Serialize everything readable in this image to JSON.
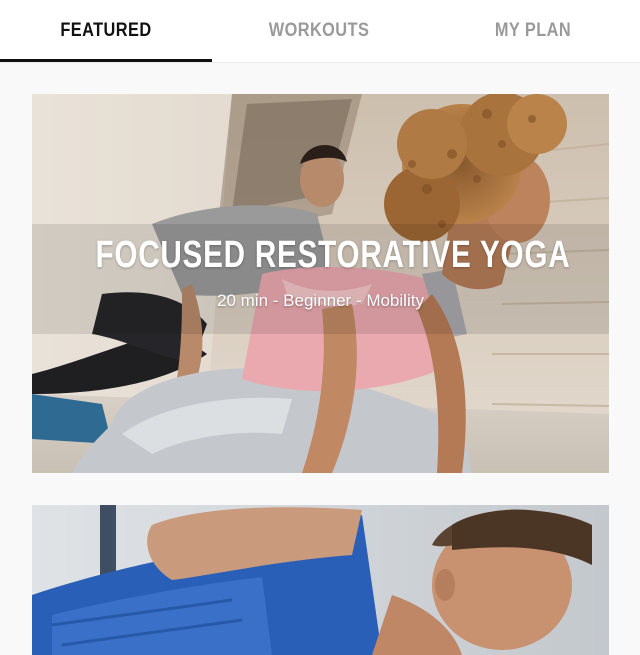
{
  "tabs": [
    {
      "label": "FEATURED",
      "active": true
    },
    {
      "label": "WORKOUTS",
      "active": false
    },
    {
      "label": "MY PLAN",
      "active": false
    }
  ],
  "cards": [
    {
      "title": "FOCUSED RESTORATIVE YOGA",
      "meta": "20 min - Beginner - Mobility",
      "image": "two people doing a kneeling lunge stretch"
    },
    {
      "image": "man in blue shirt stretching"
    }
  ],
  "colors": {
    "active_tab": "#111111",
    "inactive_tab": "#9a9a9a",
    "indicator": "#111111",
    "card_text": "#ffffff"
  }
}
